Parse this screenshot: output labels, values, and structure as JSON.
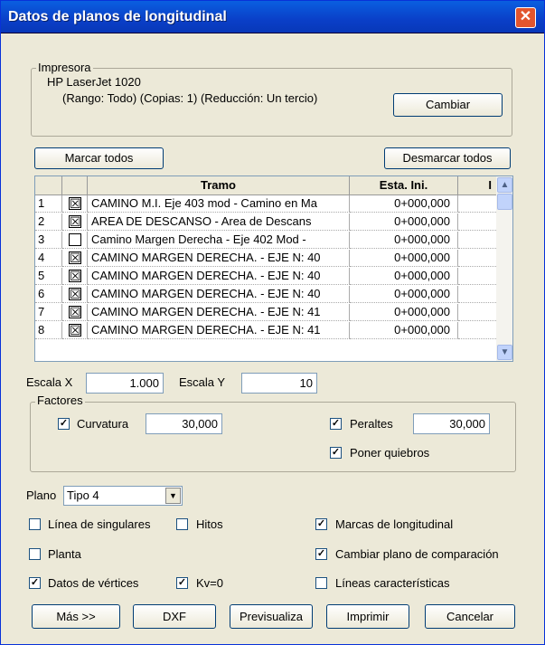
{
  "window": {
    "title": "Datos de planos de longitudinal",
    "close": "✕"
  },
  "printer": {
    "group_label": "Impresora",
    "name": "HP LaserJet 1020",
    "details": "(Rango: Todo) (Copias: 1) (Reducción: Un tercio)",
    "change_button": "Cambiar"
  },
  "selection": {
    "mark_all": "Marcar todos",
    "unmark_all": "Desmarcar todos"
  },
  "table": {
    "headers": {
      "tramo": "Tramo",
      "esta_ini": "Esta. Ini.",
      "extra": "I"
    },
    "rows": [
      {
        "num": "1",
        "checked": true,
        "tramo": "CAMINO M.I. Eje 403 mod - Camino en Ma",
        "esta": "0+000,000"
      },
      {
        "num": "2",
        "checked": true,
        "tramo": "AREA DE DESCANSO - Area de Descans",
        "esta": "0+000,000"
      },
      {
        "num": "3",
        "checked": false,
        "tramo": "Camino Margen Derecha - Eje 402 Mod -",
        "esta": "0+000,000"
      },
      {
        "num": "4",
        "checked": true,
        "tramo": "CAMINO MARGEN DERECHA. -  EJE N: 40",
        "esta": "0+000,000"
      },
      {
        "num": "5",
        "checked": true,
        "tramo": "CAMINO MARGEN DERECHA. -  EJE N: 40",
        "esta": "0+000,000"
      },
      {
        "num": "6",
        "checked": true,
        "tramo": "CAMINO MARGEN DERECHA. -  EJE N: 40",
        "esta": "0+000,000"
      },
      {
        "num": "7",
        "checked": true,
        "tramo": "CAMINO MARGEN DERECHA. -  EJE N: 41",
        "esta": "0+000,000"
      },
      {
        "num": "8",
        "checked": true,
        "tramo": "CAMINO MARGEN DERECHA. -  EJE N: 41",
        "esta": "0+000,000"
      }
    ]
  },
  "scales": {
    "x_label": "Escala X",
    "x_value": "1.000",
    "y_label": "Escala Y",
    "y_value": "10"
  },
  "factors": {
    "group_label": "Factores",
    "curvature_label": "Curvatura",
    "curvature_value": "30,000",
    "cant_label": "Peraltes",
    "cant_value": "30,000",
    "breaks_label": "Poner quiebros"
  },
  "plane": {
    "label": "Plano",
    "value": "Tipo 4"
  },
  "options": {
    "singular_line": "Línea de singulares",
    "milestones": "Hitos",
    "longitudinal_marks": "Marcas de longitudinal",
    "plan": "Planta",
    "change_comparison": "Cambiar plano de comparación",
    "vertex_data": "Datos de vértices",
    "kv_zero": "Kv=0",
    "characteristic_lines": "Líneas características"
  },
  "buttons": {
    "more": "Más >>",
    "dxf": "DXF",
    "preview": "Previsualiza",
    "print": "Imprimir",
    "cancel": "Cancelar"
  },
  "icons": {
    "check": "✓",
    "cross": "☒",
    "scroll_up": "▲",
    "scroll_down": "▼",
    "combo_arrow": "▼"
  }
}
